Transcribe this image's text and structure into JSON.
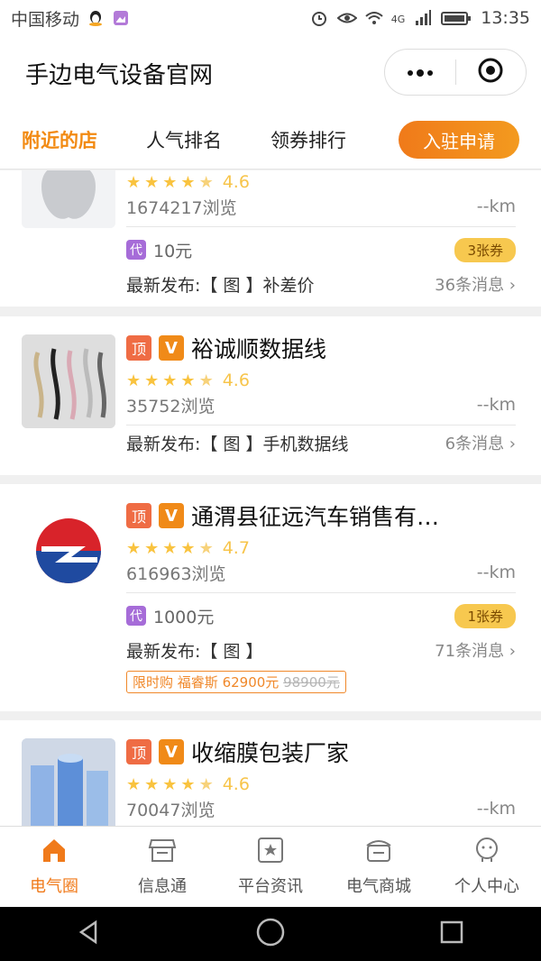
{
  "status": {
    "carrier": "中国移动",
    "network": "4G",
    "time": "13:35"
  },
  "header": {
    "title": "手边电气设备官网"
  },
  "tabs": [
    {
      "label": "附近的店",
      "active": true
    },
    {
      "label": "人气排名",
      "active": false
    },
    {
      "label": "领券排行",
      "active": false
    }
  ],
  "join_button": "入驻申请",
  "shops": [
    {
      "name": "",
      "rating": "4.6",
      "views": "1674217浏览",
      "distance": "--km",
      "coupon": {
        "icon": "代",
        "amount": "10元",
        "count": "3张券"
      },
      "news": "最新发布:【 图 】补差价",
      "messages": "36条消息",
      "thumb_icon": "apple-logo"
    },
    {
      "name": "裕诚顺数据线",
      "badge_top": "顶",
      "badge_v": "V",
      "rating": "4.6",
      "views": "35752浏览",
      "distance": "--km",
      "news": "最新发布:【 图 】手机数据线",
      "messages": "6条消息",
      "thumb_icon": "usb-cables"
    },
    {
      "name": "通渭县征远汽车销售有…",
      "badge_top": "顶",
      "badge_v": "V",
      "rating": "4.7",
      "views": "616963浏览",
      "distance": "--km",
      "coupon": {
        "icon": "代",
        "amount": "1000元",
        "count": "1张券"
      },
      "news": "最新发布:【 图 】",
      "messages": "71条消息",
      "flash": {
        "label": "限时购",
        "brand": "福睿斯",
        "price": "62900元",
        "old_price": "98900元"
      },
      "thumb_icon": "car-brand-logo"
    },
    {
      "name": "收缩膜包装厂家",
      "badge_top": "顶",
      "badge_v": "V",
      "rating": "4.6",
      "views": "70047浏览",
      "distance": "--km",
      "thumb_icon": "film-rolls"
    }
  ],
  "bottom_nav": [
    {
      "label": "电气圈",
      "icon": "home-icon",
      "active": true
    },
    {
      "label": "信息通",
      "icon": "store-icon",
      "active": false
    },
    {
      "label": "平台资讯",
      "icon": "star-box-icon",
      "active": false
    },
    {
      "label": "电气商城",
      "icon": "shop-icon",
      "active": false
    },
    {
      "label": "个人中心",
      "icon": "user-icon",
      "active": false
    }
  ],
  "colors": {
    "accent": "#f28a12",
    "star": "#f9c33f",
    "coupon_badge": "#f7c84f"
  }
}
